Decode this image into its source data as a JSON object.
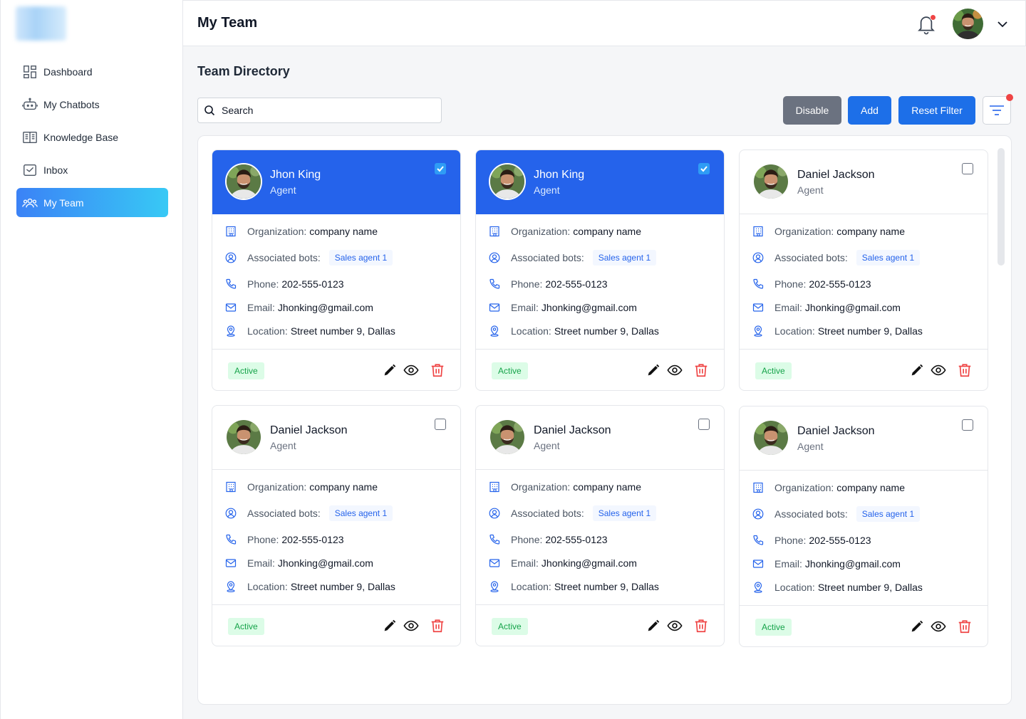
{
  "sidebar": {
    "items": [
      {
        "label": "Dashboard",
        "icon": "dashboard-icon",
        "active": false
      },
      {
        "label": "My Chatbots",
        "icon": "chatbot-icon",
        "active": false
      },
      {
        "label": "Knowledge Base",
        "icon": "book-icon",
        "active": false
      },
      {
        "label": "Inbox",
        "icon": "inbox-icon",
        "active": false
      },
      {
        "label": "My Team",
        "icon": "team-icon",
        "active": true
      }
    ]
  },
  "header": {
    "title": "My Team"
  },
  "directory": {
    "title": "Team Directory",
    "search_placeholder": "Search",
    "buttons": {
      "disable": "Disable",
      "add": "Add",
      "reset": "Reset Filter"
    }
  },
  "colors": {
    "primary": "#2563eb",
    "accent_gradient_end": "#38c9f5",
    "danger": "#ef4444",
    "success": "#16a34a"
  },
  "cards": [
    {
      "name": "Jhon King",
      "role": "Agent",
      "selected": true,
      "org_label": "Organization:",
      "org": "company name",
      "bots_label": "Associated bots:",
      "bot": "Sales agent 1",
      "phone_label": "Phone:",
      "phone": "202-555-0123",
      "email_label": "Email:",
      "email": "Jhonking@gmail.com",
      "loc_label": "Location:",
      "loc": "Street number 9, Dallas",
      "status": "Active"
    },
    {
      "name": "Jhon King",
      "role": "Agent",
      "selected": true,
      "org_label": "Organization:",
      "org": "company name",
      "bots_label": "Associated bots:",
      "bot": "Sales agent 1",
      "phone_label": "Phone:",
      "phone": "202-555-0123",
      "email_label": "Email:",
      "email": "Jhonking@gmail.com",
      "loc_label": "Location:",
      "loc": "Street number 9, Dallas",
      "status": "Active"
    },
    {
      "name": "Daniel Jackson",
      "role": "Agent",
      "selected": false,
      "org_label": "Organization:",
      "org": "company name",
      "bots_label": "Associated bots:",
      "bot": "Sales agent 1",
      "phone_label": "Phone:",
      "phone": "202-555-0123",
      "email_label": "Email:",
      "email": "Jhonking@gmail.com",
      "loc_label": "Location:",
      "loc": "Street number 9, Dallas",
      "status": "Active"
    },
    {
      "name": "Daniel Jackson",
      "role": "Agent",
      "selected": false,
      "org_label": "Organization:",
      "org": "company name",
      "bots_label": "Associated bots:",
      "bot": "Sales agent 1",
      "phone_label": "Phone:",
      "phone": "202-555-0123",
      "email_label": "Email:",
      "email": "Jhonking@gmail.com",
      "loc_label": "Location:",
      "loc": "Street number 9, Dallas",
      "status": "Active"
    },
    {
      "name": "Daniel Jackson",
      "role": "Agent",
      "selected": false,
      "org_label": "Organization:",
      "org": "company name",
      "bots_label": "Associated bots:",
      "bot": "Sales agent 1",
      "phone_label": "Phone:",
      "phone": "202-555-0123",
      "email_label": "Email:",
      "email": "Jhonking@gmail.com",
      "loc_label": "Location:",
      "loc": "Street number 9, Dallas",
      "status": "Active"
    },
    {
      "name": "Daniel Jackson",
      "role": "Agent",
      "selected": false,
      "org_label": "Organization:",
      "org": "company name",
      "bots_label": "Associated bots:",
      "bot": "Sales agent 1",
      "phone_label": "Phone:",
      "phone": "202-555-0123",
      "email_label": "Email:",
      "email": "Jhonking@gmail.com",
      "loc_label": "Location:",
      "loc": "Street number 9, Dallas",
      "status": "Active"
    }
  ]
}
